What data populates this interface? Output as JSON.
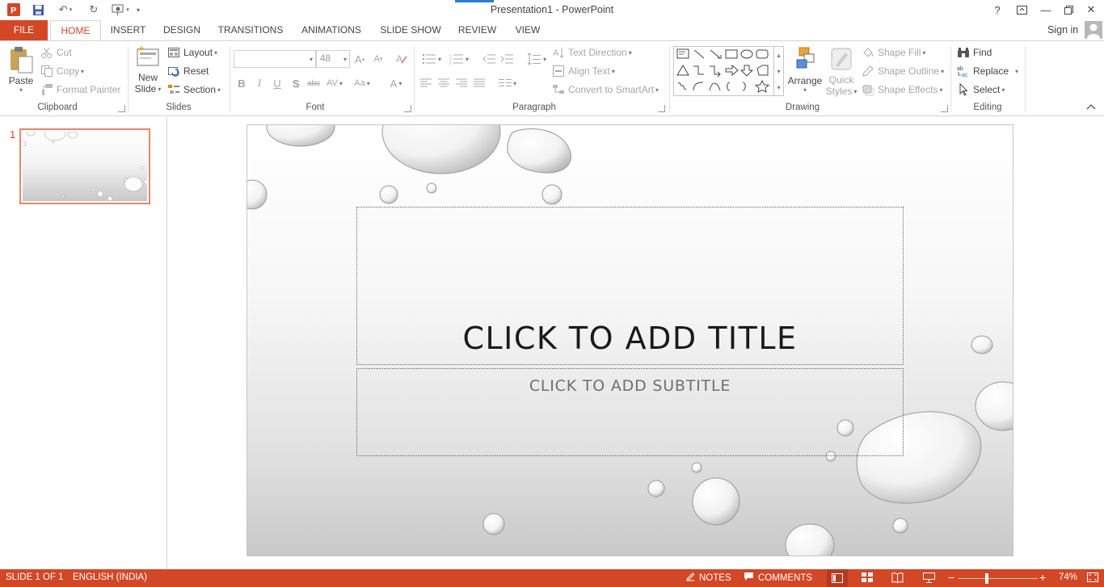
{
  "window": {
    "title": "Presentation1 - PowerPoint",
    "sign_in": "Sign in"
  },
  "tabs": [
    {
      "label": "FILE"
    },
    {
      "label": "HOME"
    },
    {
      "label": "INSERT"
    },
    {
      "label": "DESIGN"
    },
    {
      "label": "TRANSITIONS"
    },
    {
      "label": "ANIMATIONS"
    },
    {
      "label": "SLIDE SHOW"
    },
    {
      "label": "REVIEW"
    },
    {
      "label": "VIEW"
    }
  ],
  "ribbon": {
    "clipboard": {
      "label": "Clipboard",
      "paste": "Paste",
      "cut": "Cut",
      "copy": "Copy",
      "format_painter": "Format Painter"
    },
    "slides": {
      "label": "Slides",
      "new_slide_line1": "New",
      "new_slide_line2": "Slide",
      "layout": "Layout",
      "reset": "Reset",
      "section": "Section"
    },
    "font": {
      "label": "Font",
      "font_name": "",
      "font_size": "48",
      "grow": "A",
      "shrink": "A",
      "bold": "B",
      "italic": "I",
      "underline": "U",
      "shadow": "S",
      "strike": "abc",
      "spacing": "AV",
      "case": "Aa",
      "color": "A"
    },
    "paragraph": {
      "label": "Paragraph",
      "text_direction": "Text Direction",
      "align_text": "Align Text",
      "convert_smartart": "Convert to SmartArt"
    },
    "drawing": {
      "label": "Drawing",
      "arrange": "Arrange",
      "quick_styles_line1": "Quick",
      "quick_styles_line2": "Styles",
      "shape_fill": "Shape Fill",
      "shape_outline": "Shape Outline",
      "shape_effects": "Shape Effects"
    },
    "editing": {
      "label": "Editing",
      "find": "Find",
      "replace": "Replace",
      "select": "Select"
    }
  },
  "thumbnails": [
    {
      "number": "1"
    }
  ],
  "slide": {
    "title_placeholder": "CLICK TO ADD TITLE",
    "subtitle_placeholder": "CLICK TO ADD SUBTITLE"
  },
  "status": {
    "slide_info": "SLIDE 1 OF 1",
    "language": "ENGLISH (INDIA)",
    "notes": "NOTES",
    "comments": "COMMENTS",
    "zoom": "74%"
  },
  "colors": {
    "accent": "#d24726",
    "thumb_border": "#e8876c"
  }
}
